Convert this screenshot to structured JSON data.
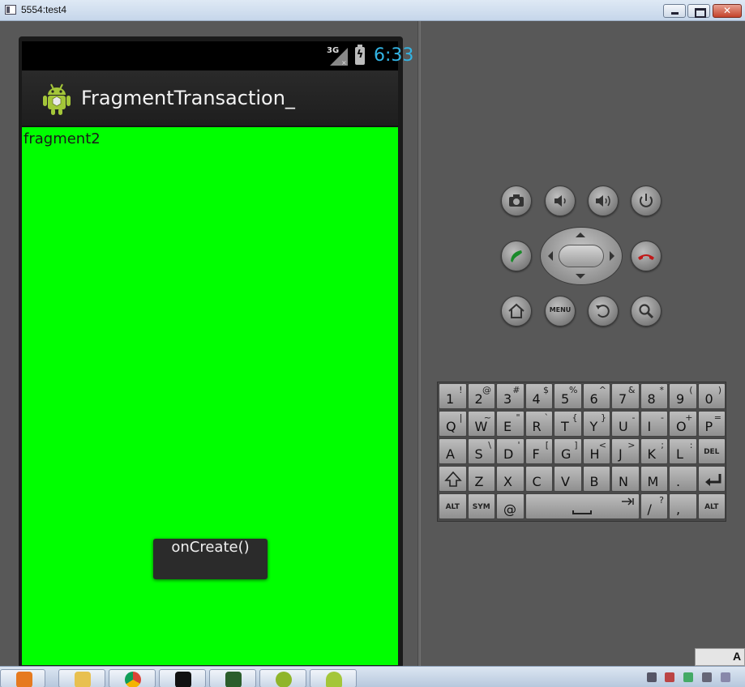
{
  "window": {
    "title": "5554:test4"
  },
  "status_bar": {
    "network": "3G",
    "time": "6:33",
    "clock_color": "#33b5e5"
  },
  "action_bar": {
    "title": "FragmentTransaction_"
  },
  "content": {
    "fragment_label": "fragment2",
    "background": "#00ff00"
  },
  "toast": {
    "text": "onCreate()"
  },
  "hardware_buttons": {
    "camera": "camera-icon",
    "volume_down": "volume-down-icon",
    "volume_up": "volume-up-icon",
    "power": "power-icon",
    "call": "call-icon",
    "end_call": "end-call-icon",
    "home": "home-icon",
    "menu": "MENU",
    "back": "back-icon",
    "search": "search-icon"
  },
  "keyboard": {
    "rows": [
      [
        [
          "1",
          "!"
        ],
        [
          "2",
          "@"
        ],
        [
          "3",
          "#"
        ],
        [
          "4",
          "$"
        ],
        [
          "5",
          "%"
        ],
        [
          "6",
          "^"
        ],
        [
          "7",
          "&"
        ],
        [
          "8",
          "*"
        ],
        [
          "9",
          "("
        ],
        [
          "0",
          ")"
        ]
      ],
      [
        [
          "Q",
          "|"
        ],
        [
          "W",
          "~"
        ],
        [
          "E",
          "\""
        ],
        [
          "R",
          "`"
        ],
        [
          "T",
          "{"
        ],
        [
          "Y",
          "}"
        ],
        [
          "U",
          "-"
        ],
        [
          "I",
          "-"
        ],
        [
          "O",
          "+"
        ],
        [
          "P",
          "="
        ]
      ],
      [
        [
          "A",
          ""
        ],
        [
          "S",
          "\\"
        ],
        [
          "D",
          "'"
        ],
        [
          "F",
          "["
        ],
        [
          "G",
          "]"
        ],
        [
          "H",
          "<"
        ],
        [
          "J",
          ">"
        ],
        [
          "K",
          ";"
        ],
        [
          "L",
          ":"
        ]
      ],
      [
        [
          "Z",
          ""
        ],
        [
          "X",
          ""
        ],
        [
          "C",
          ""
        ],
        [
          "V",
          ""
        ],
        [
          "B",
          ""
        ],
        [
          "N",
          ""
        ],
        [
          "M",
          ""
        ],
        [
          ".",
          ""
        ]
      ]
    ],
    "del_label": "DEL",
    "alt_label": "ALT",
    "sym_label": "SYM",
    "at_label": "@",
    "slash_label": "/",
    "slash_alt": "?",
    "comma_label": ","
  },
  "tray": {
    "text": "A"
  }
}
